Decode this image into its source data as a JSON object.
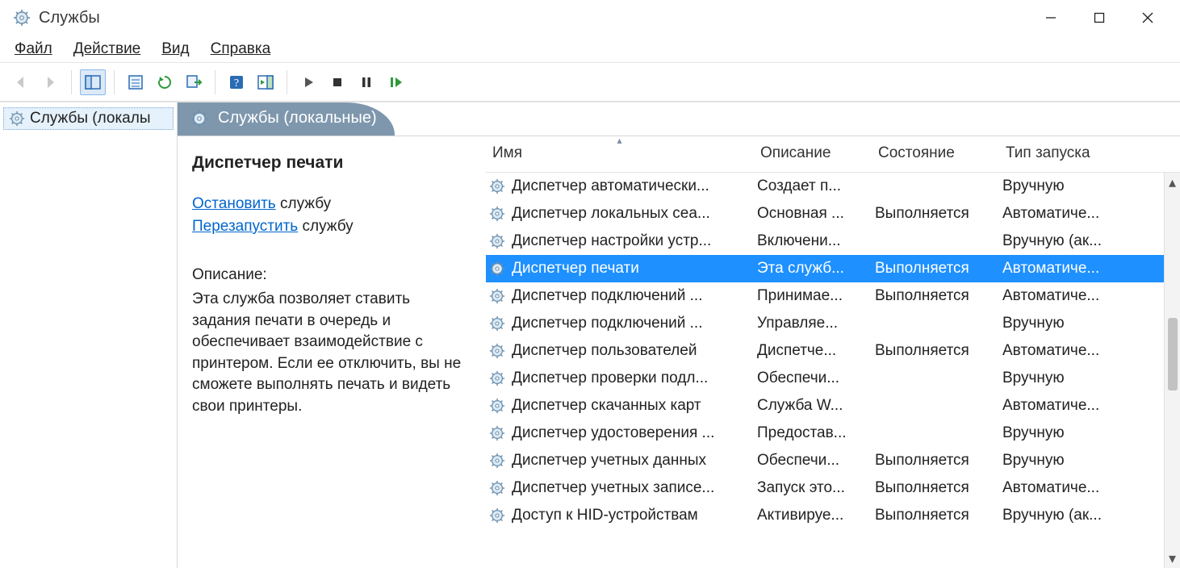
{
  "window": {
    "title": "Службы"
  },
  "menu": {
    "file": "Файл",
    "action": "Действие",
    "view": "Вид",
    "help": "Справка"
  },
  "tree": {
    "root": "Службы (локалы"
  },
  "tab": {
    "title": "Службы (локальные)"
  },
  "detail": {
    "title": "Диспетчер печати",
    "stop_link": "Остановить",
    "stop_rest": " службу",
    "restart_link": "Перезапустить",
    "restart_rest": " службу",
    "desc_label": "Описание:",
    "desc_text": "Эта служба позволяет ставить задания печати в очередь и обеспечивает взаимодействие с принтером. Если ее отключить, вы не сможете выполнять печать и видеть свои принтеры."
  },
  "columns": {
    "name": "Имя",
    "desc": "Описание",
    "state": "Состояние",
    "startup": "Тип запуска"
  },
  "rows": [
    {
      "name": "Диспетчер автоматически...",
      "desc": "Создает п...",
      "state": "",
      "startup": "Вручную",
      "selected": false
    },
    {
      "name": "Диспетчер локальных сеа...",
      "desc": "Основная ...",
      "state": "Выполняется",
      "startup": "Автоматиче...",
      "selected": false
    },
    {
      "name": "Диспетчер настройки устр...",
      "desc": "Включени...",
      "state": "",
      "startup": "Вручную (ак...",
      "selected": false
    },
    {
      "name": "Диспетчер печати",
      "desc": "Эта служб...",
      "state": "Выполняется",
      "startup": "Автоматиче...",
      "selected": true
    },
    {
      "name": "Диспетчер подключений ...",
      "desc": "Принимае...",
      "state": "Выполняется",
      "startup": "Автоматиче...",
      "selected": false
    },
    {
      "name": "Диспетчер подключений ...",
      "desc": "Управляе...",
      "state": "",
      "startup": "Вручную",
      "selected": false
    },
    {
      "name": "Диспетчер пользователей",
      "desc": "Диспетче...",
      "state": "Выполняется",
      "startup": "Автоматиче...",
      "selected": false
    },
    {
      "name": "Диспетчер проверки подл...",
      "desc": "Обеспечи...",
      "state": "",
      "startup": "Вручную",
      "selected": false
    },
    {
      "name": "Диспетчер скачанных карт",
      "desc": "Служба W...",
      "state": "",
      "startup": "Автоматиче...",
      "selected": false
    },
    {
      "name": "Диспетчер удостоверения ...",
      "desc": "Предостав...",
      "state": "",
      "startup": "Вручную",
      "selected": false
    },
    {
      "name": "Диспетчер учетных данных",
      "desc": "Обеспечи...",
      "state": "Выполняется",
      "startup": "Вручную",
      "selected": false
    },
    {
      "name": "Диспетчер учетных записе...",
      "desc": "Запуск это...",
      "state": "Выполняется",
      "startup": "Автоматиче...",
      "selected": false
    },
    {
      "name": "Доступ к HID-устройствам",
      "desc": "Активируе...",
      "state": "Выполняется",
      "startup": "Вручную (ак...",
      "selected": false
    }
  ]
}
